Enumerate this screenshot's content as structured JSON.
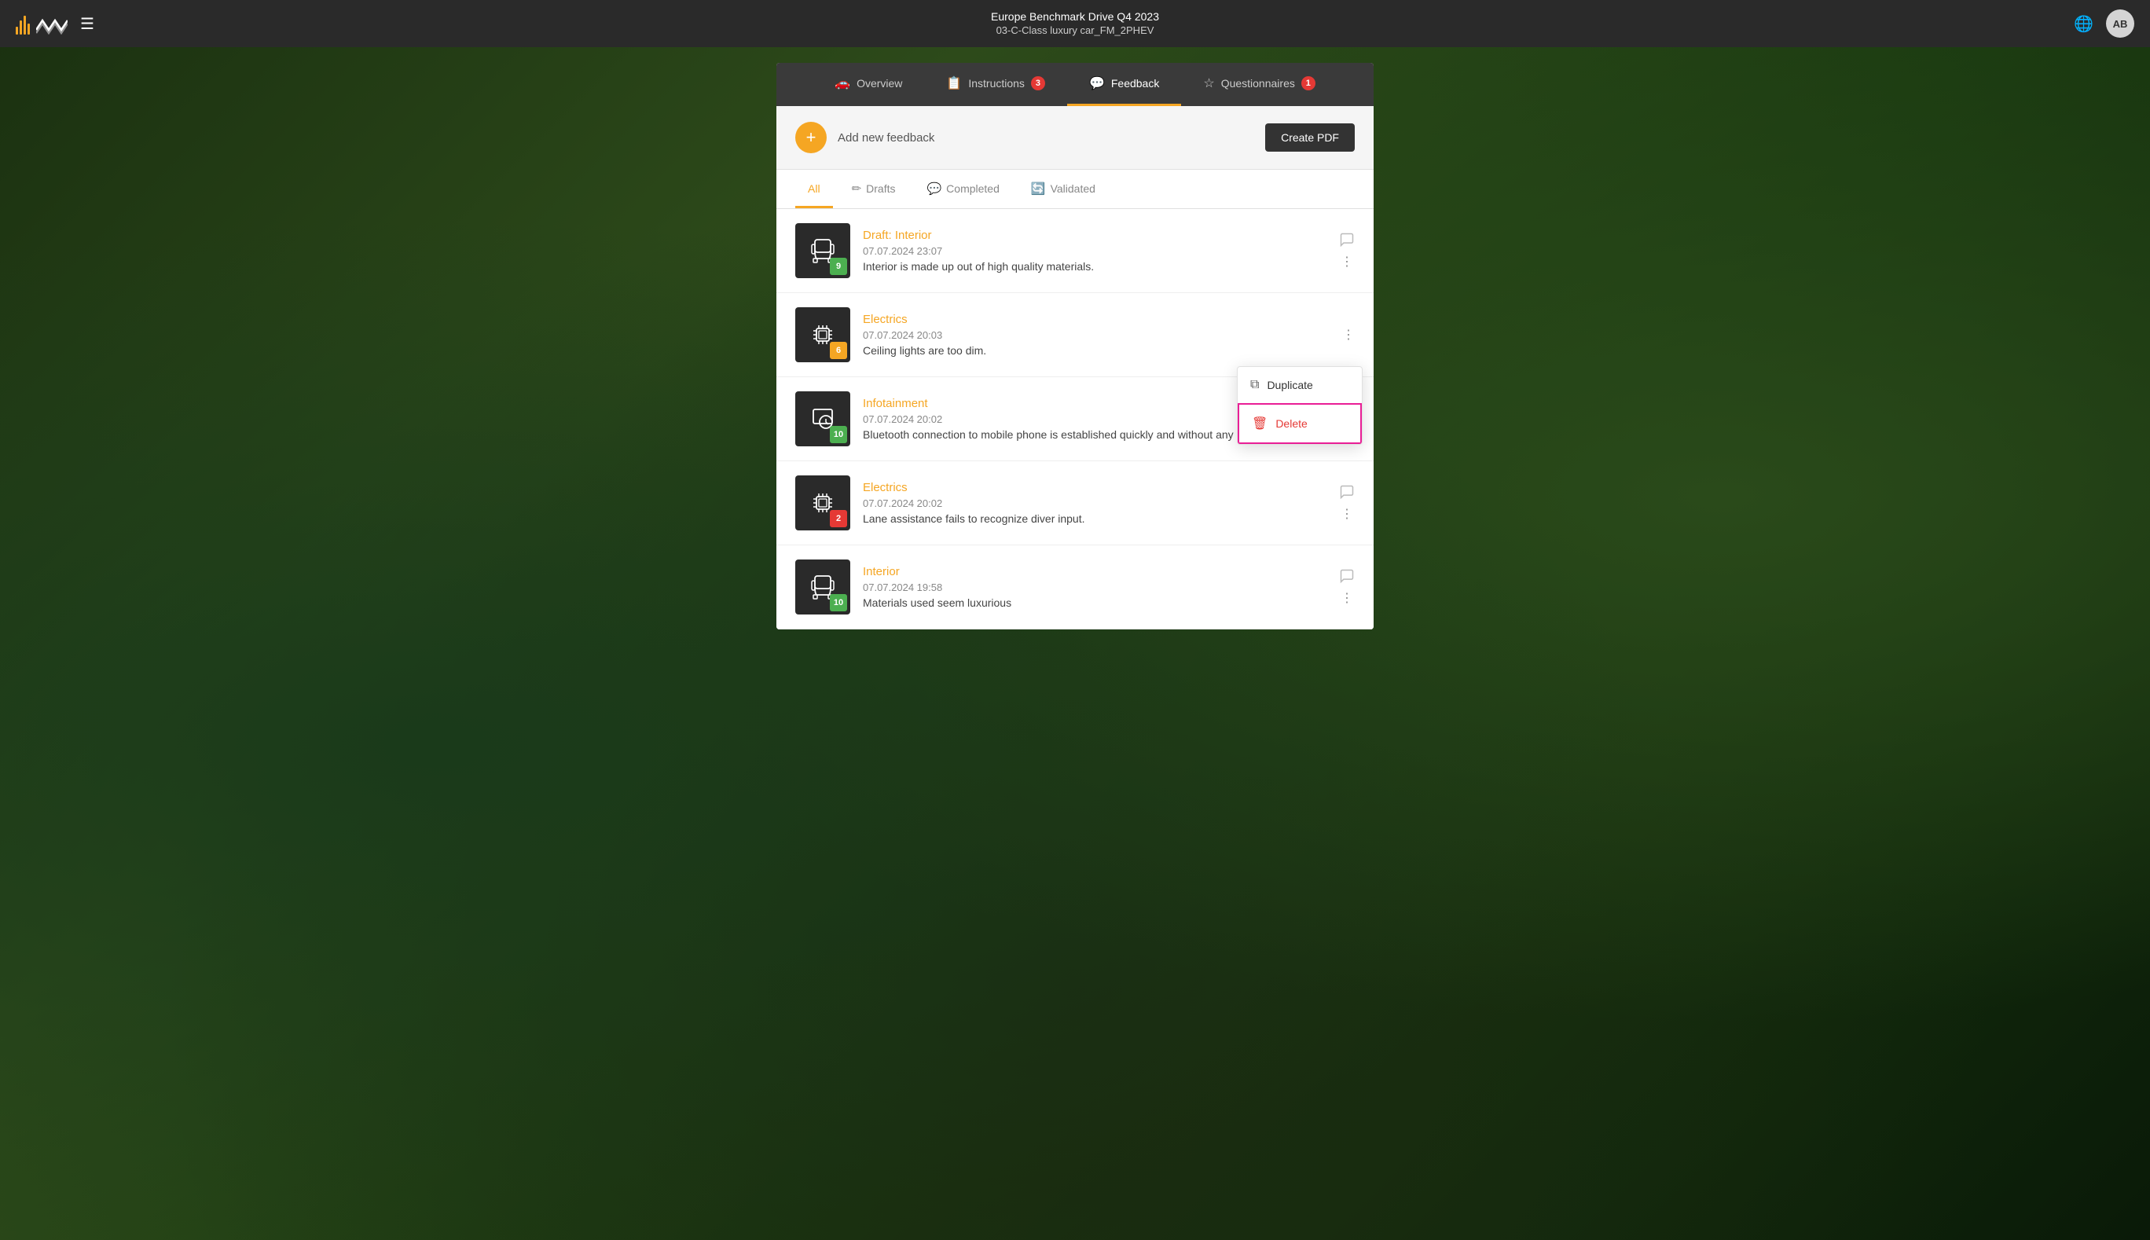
{
  "navbar": {
    "title_main": "Europe Benchmark Drive Q4 2023",
    "title_sub": "03-C-Class luxury car_FM_2PHEV",
    "avatar_initials": "AB"
  },
  "tabs": [
    {
      "id": "overview",
      "label": "Overview",
      "icon": "car",
      "badge": null,
      "active": false
    },
    {
      "id": "instructions",
      "label": "Instructions",
      "icon": "list",
      "badge": "3",
      "active": false
    },
    {
      "id": "feedback",
      "label": "Feedback",
      "icon": "chat",
      "badge": null,
      "active": true
    },
    {
      "id": "questionnaires",
      "label": "Questionnaires",
      "icon": "star",
      "badge": "1",
      "active": false
    }
  ],
  "header": {
    "add_label": "Add new feedback",
    "create_pdf_label": "Create PDF"
  },
  "filter_tabs": [
    {
      "id": "all",
      "label": "All",
      "active": true
    },
    {
      "id": "drafts",
      "label": "Drafts",
      "active": false
    },
    {
      "id": "completed",
      "label": "Completed",
      "active": false
    },
    {
      "id": "validated",
      "label": "Validated",
      "active": false
    }
  ],
  "feedback_items": [
    {
      "id": 1,
      "category": "Draft: Interior",
      "date": "07.07.2024 23:07",
      "text": "Interior is made up out of high quality materials.",
      "icon_type": "seat",
      "score": "9",
      "score_color": "green",
      "has_comment": true,
      "show_menu": false
    },
    {
      "id": 2,
      "category": "Electrics",
      "date": "07.07.2024 20:03",
      "text": "Ceiling lights are too dim.",
      "icon_type": "chip",
      "score": "6",
      "score_color": "yellow",
      "has_comment": false,
      "show_menu": true
    },
    {
      "id": 3,
      "category": "Infotainment",
      "date": "07.07.2024 20:02",
      "text": "Bluetooth connection to mobile phone is established quickly and without any problems.",
      "icon_type": "touch",
      "score": "10",
      "score_color": "green",
      "has_comment": true,
      "show_menu": false
    },
    {
      "id": 4,
      "category": "Electrics",
      "date": "07.07.2024 20:02",
      "text": "Lane assistance fails to recognize diver input.",
      "icon_type": "chip",
      "score": "2",
      "score_color": "red",
      "has_comment": true,
      "show_menu": false
    },
    {
      "id": 5,
      "category": "Interior",
      "date": "07.07.2024 19:58",
      "text": "Materials used seem luxurious",
      "icon_type": "seat",
      "score": "10",
      "score_color": "green",
      "has_comment": true,
      "show_menu": false
    }
  ],
  "context_menu": {
    "duplicate_label": "Duplicate",
    "delete_label": "Delete"
  }
}
